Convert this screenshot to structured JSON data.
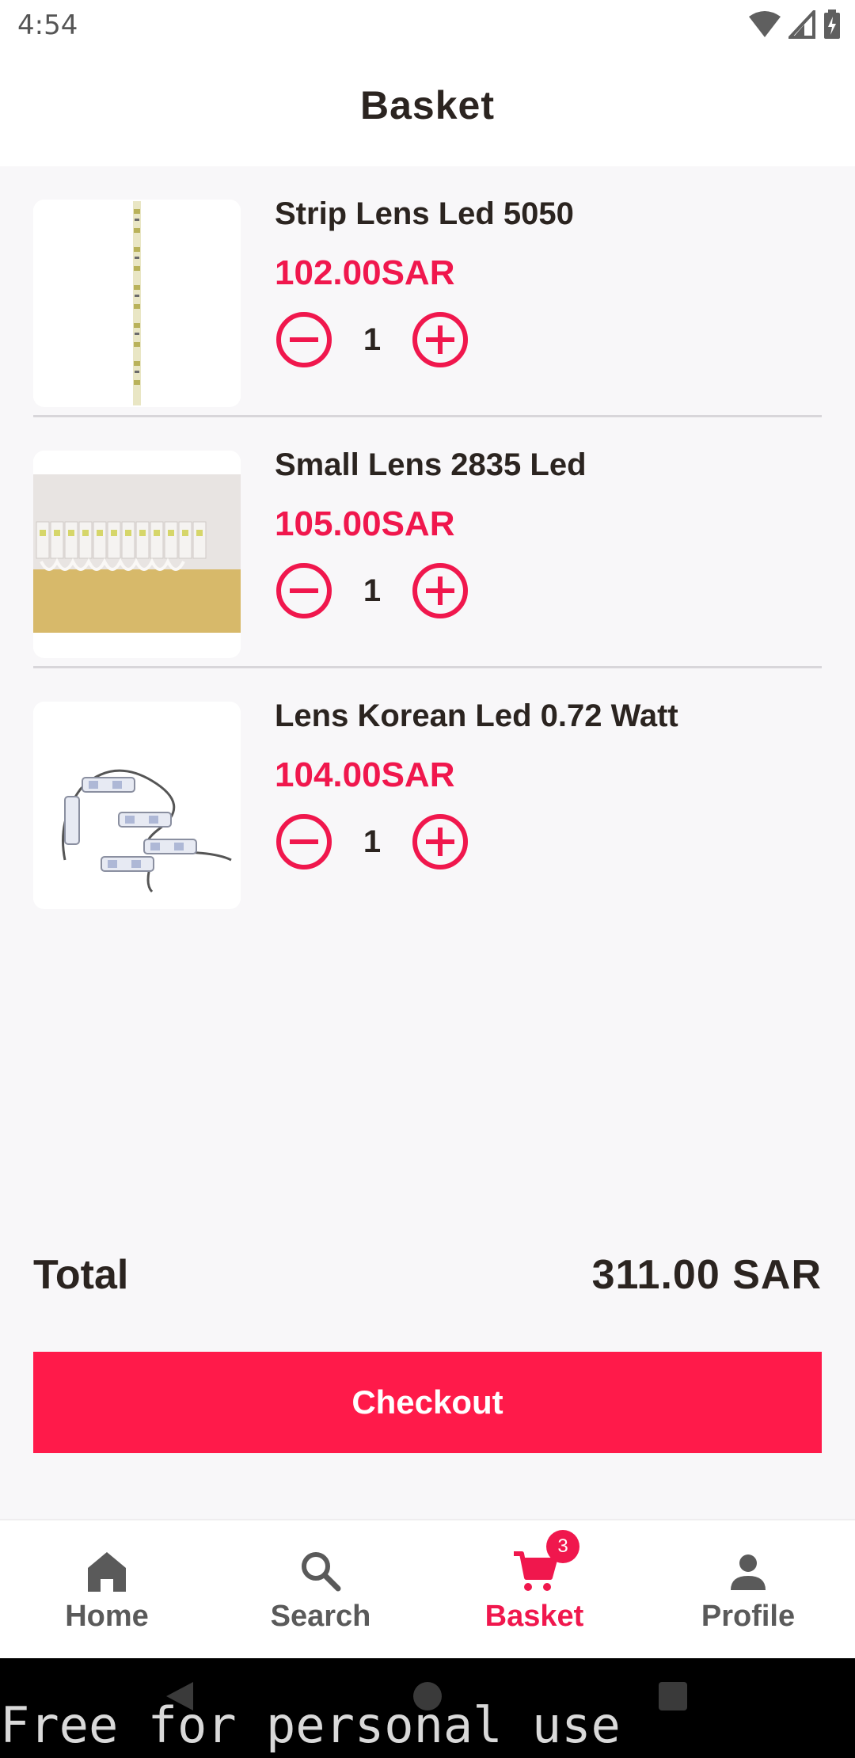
{
  "status_bar": {
    "time": "4:54",
    "icons": [
      "wifi-icon",
      "signal-icon",
      "battery-icon"
    ]
  },
  "header": {
    "title": "Basket"
  },
  "basket": {
    "items": [
      {
        "name": "Strip Lens Led 5050",
        "price": "102.00SAR",
        "quantity": "1",
        "image": "led-strip-image"
      },
      {
        "name": "Small Lens 2835 Led",
        "price": "105.00SAR",
        "quantity": "1",
        "image": "led-modules-box-image"
      },
      {
        "name": "Lens Korean Led 0.72 Watt",
        "price": "104.00SAR",
        "quantity": "1",
        "image": "led-module-chain-image"
      }
    ]
  },
  "summary": {
    "total_label": "Total",
    "total_value": "311.00 SAR",
    "checkout_label": "Checkout"
  },
  "bottom_nav": {
    "items": [
      {
        "label": "Home",
        "icon": "home-icon"
      },
      {
        "label": "Search",
        "icon": "search-icon"
      },
      {
        "label": "Basket",
        "icon": "cart-icon",
        "badge": "3",
        "active": true
      },
      {
        "label": "Profile",
        "icon": "person-icon"
      }
    ]
  },
  "system_nav": {
    "buttons": [
      "back-icon",
      "home-circle-icon",
      "recents-icon"
    ]
  },
  "watermark": "Free for personal use",
  "colors": {
    "accent": "#f0174d",
    "button": "#ff1a4a",
    "text": "#2b2420",
    "background": "#f8f7f9"
  }
}
